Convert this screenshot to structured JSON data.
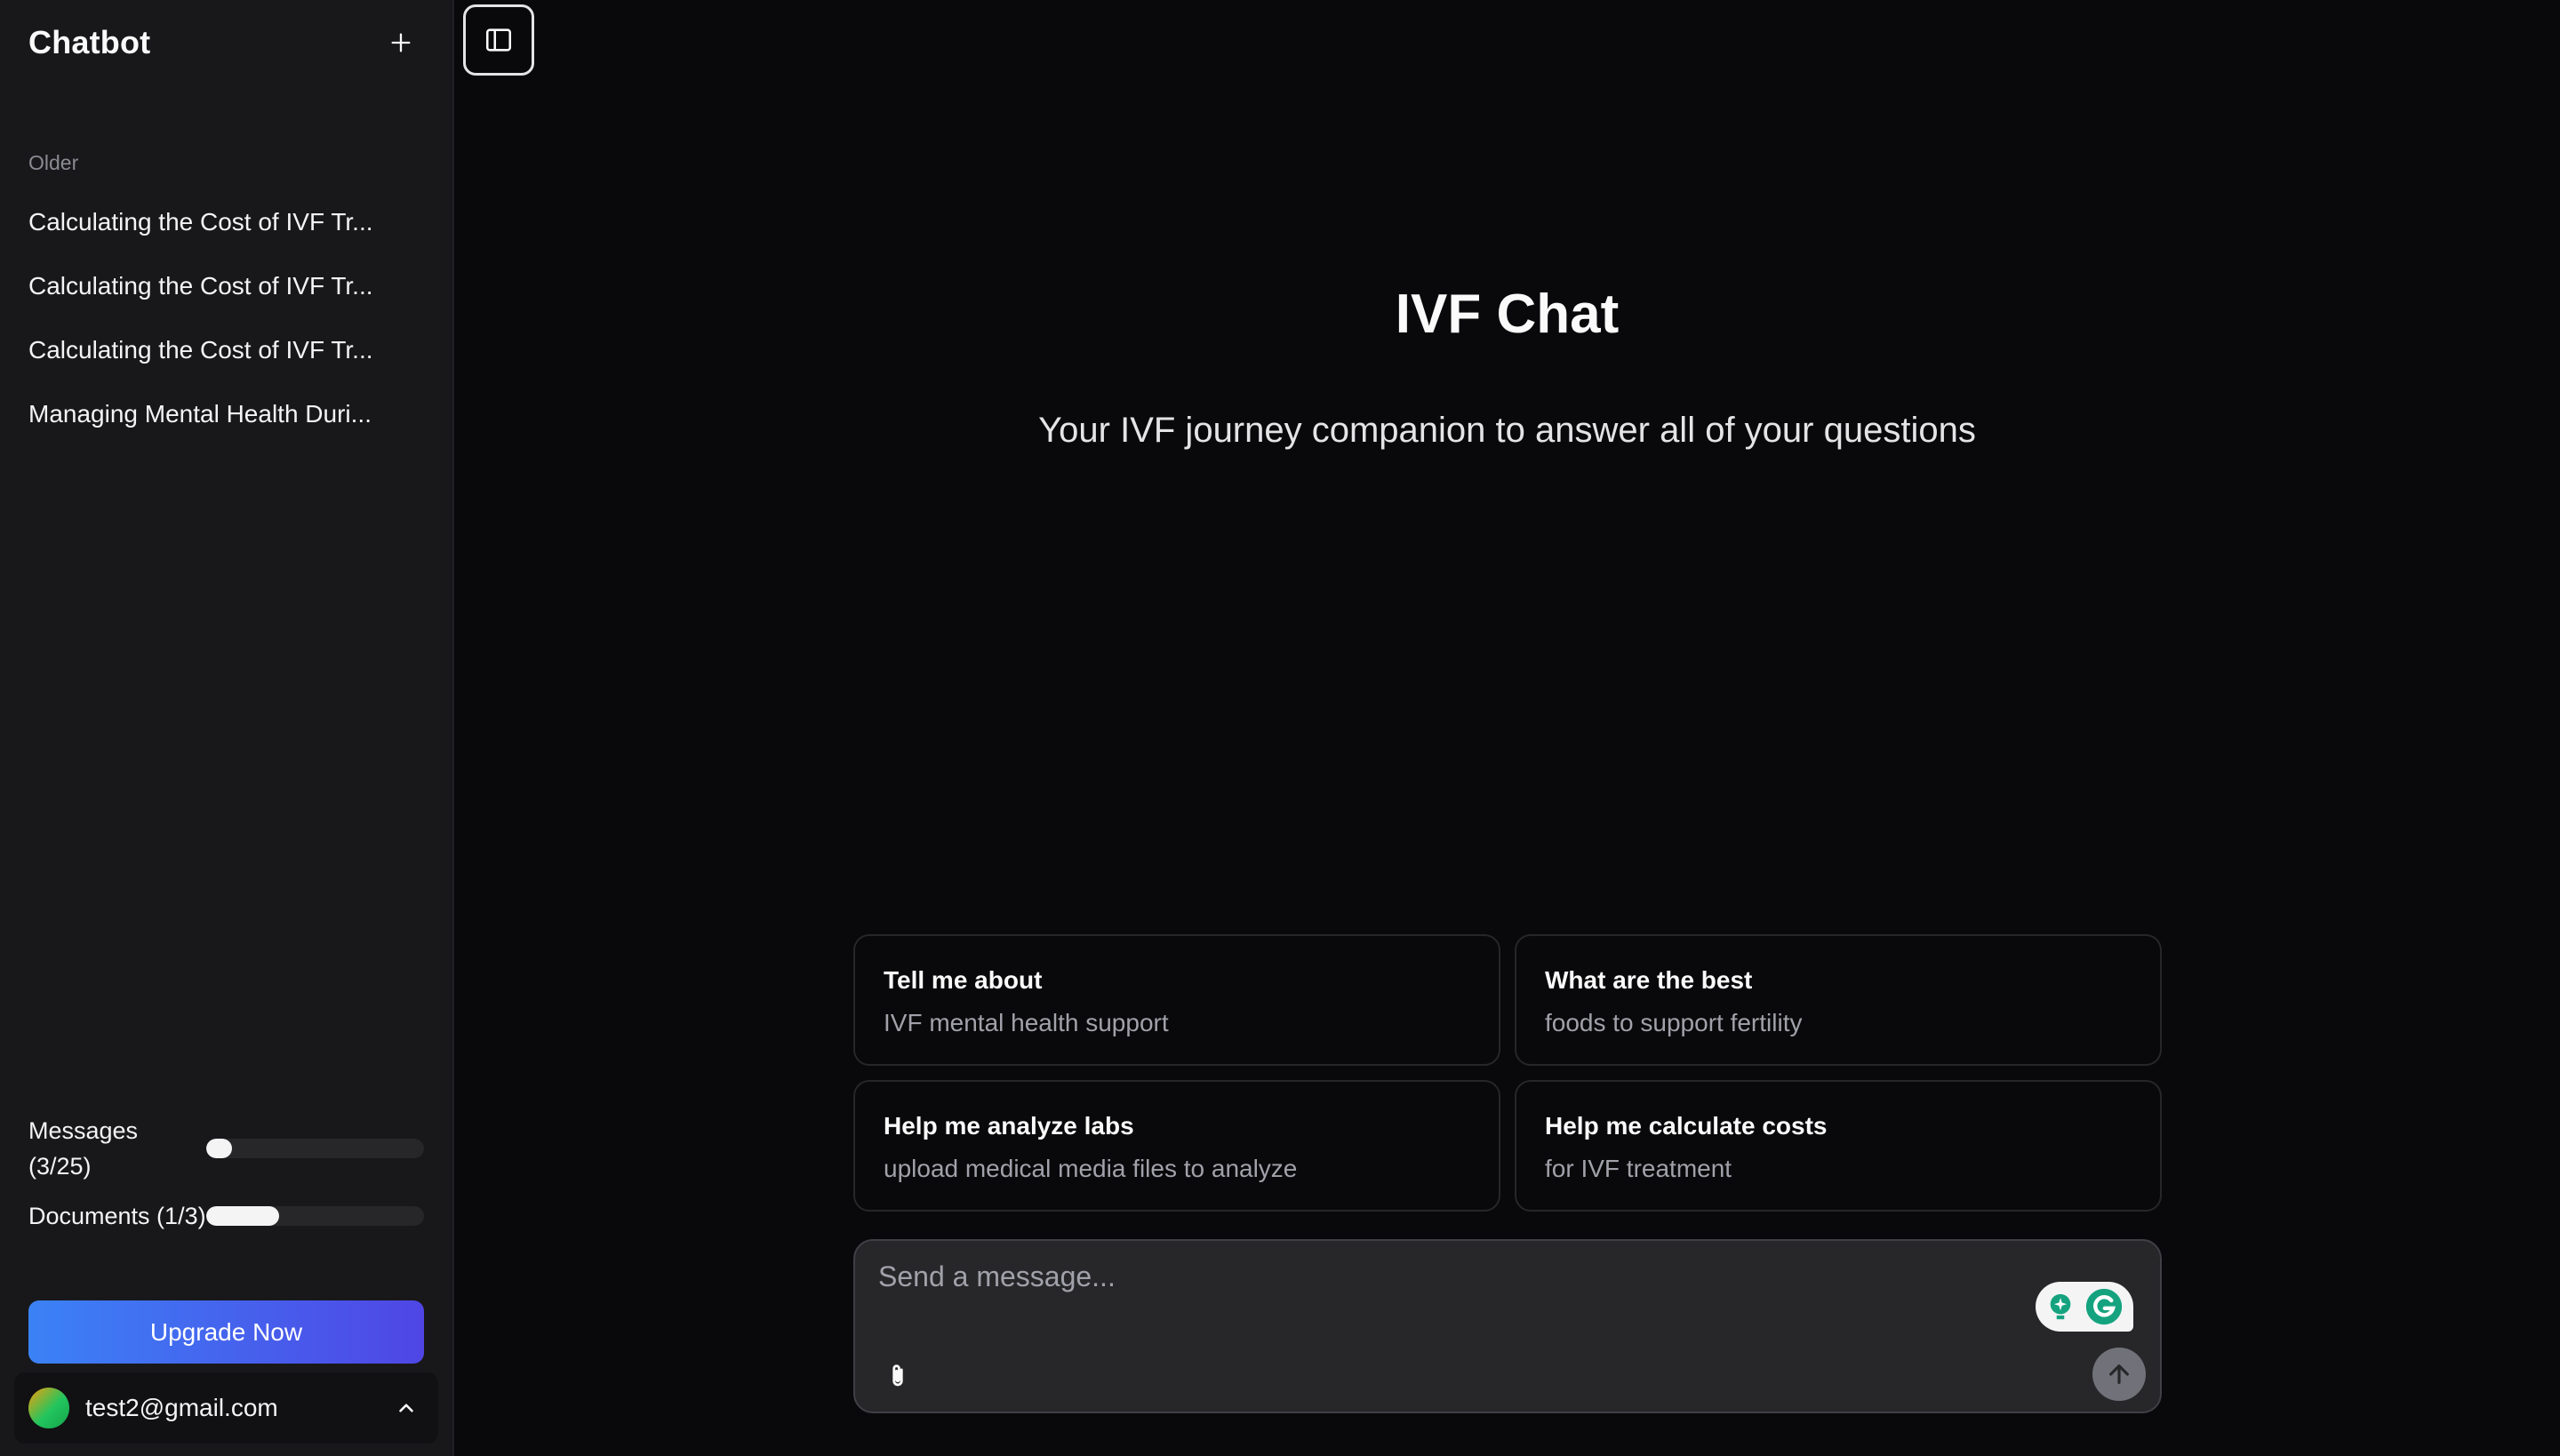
{
  "sidebar": {
    "app_title": "Chatbot",
    "section_label": "Older",
    "history": [
      {
        "label": "Calculating the Cost of IVF Tr..."
      },
      {
        "label": "Calculating the Cost of IVF Tr..."
      },
      {
        "label": "Calculating the Cost of IVF Tr..."
      },
      {
        "label": "Managing Mental Health Duri..."
      }
    ],
    "usage": {
      "messages": {
        "label": "Messages (3/25)",
        "used": 3,
        "limit": 25
      },
      "documents": {
        "label": "Documents (1/3)",
        "used": 1,
        "limit": 3
      }
    },
    "upgrade_label": "Upgrade Now",
    "user_email": "test2@gmail.com"
  },
  "main": {
    "title": "IVF Chat",
    "subtitle": "Your IVF journey companion to answer all of your questions",
    "suggestions": [
      {
        "title": "Tell me about",
        "subtitle": "IVF mental health support"
      },
      {
        "title": "What are the best",
        "subtitle": "foods to support fertility"
      },
      {
        "title": "Help me analyze labs",
        "subtitle": "upload medical media files to analyze"
      },
      {
        "title": "Help me calculate costs",
        "subtitle": "for IVF treatment"
      }
    ],
    "composer": {
      "placeholder": "Send a message..."
    }
  },
  "icons": {
    "new_chat": "plus-icon",
    "toggle": "sidebar-toggle-icon",
    "user_menu": "chevron-up-icon",
    "attach": "paperclip-icon",
    "send": "arrow-up-icon",
    "grammarly": "grammarly-icon"
  },
  "colors": {
    "background": "#09090b",
    "sidebar": "#18181b",
    "accent_start": "#3b82f6",
    "accent_end": "#4f46e5"
  }
}
